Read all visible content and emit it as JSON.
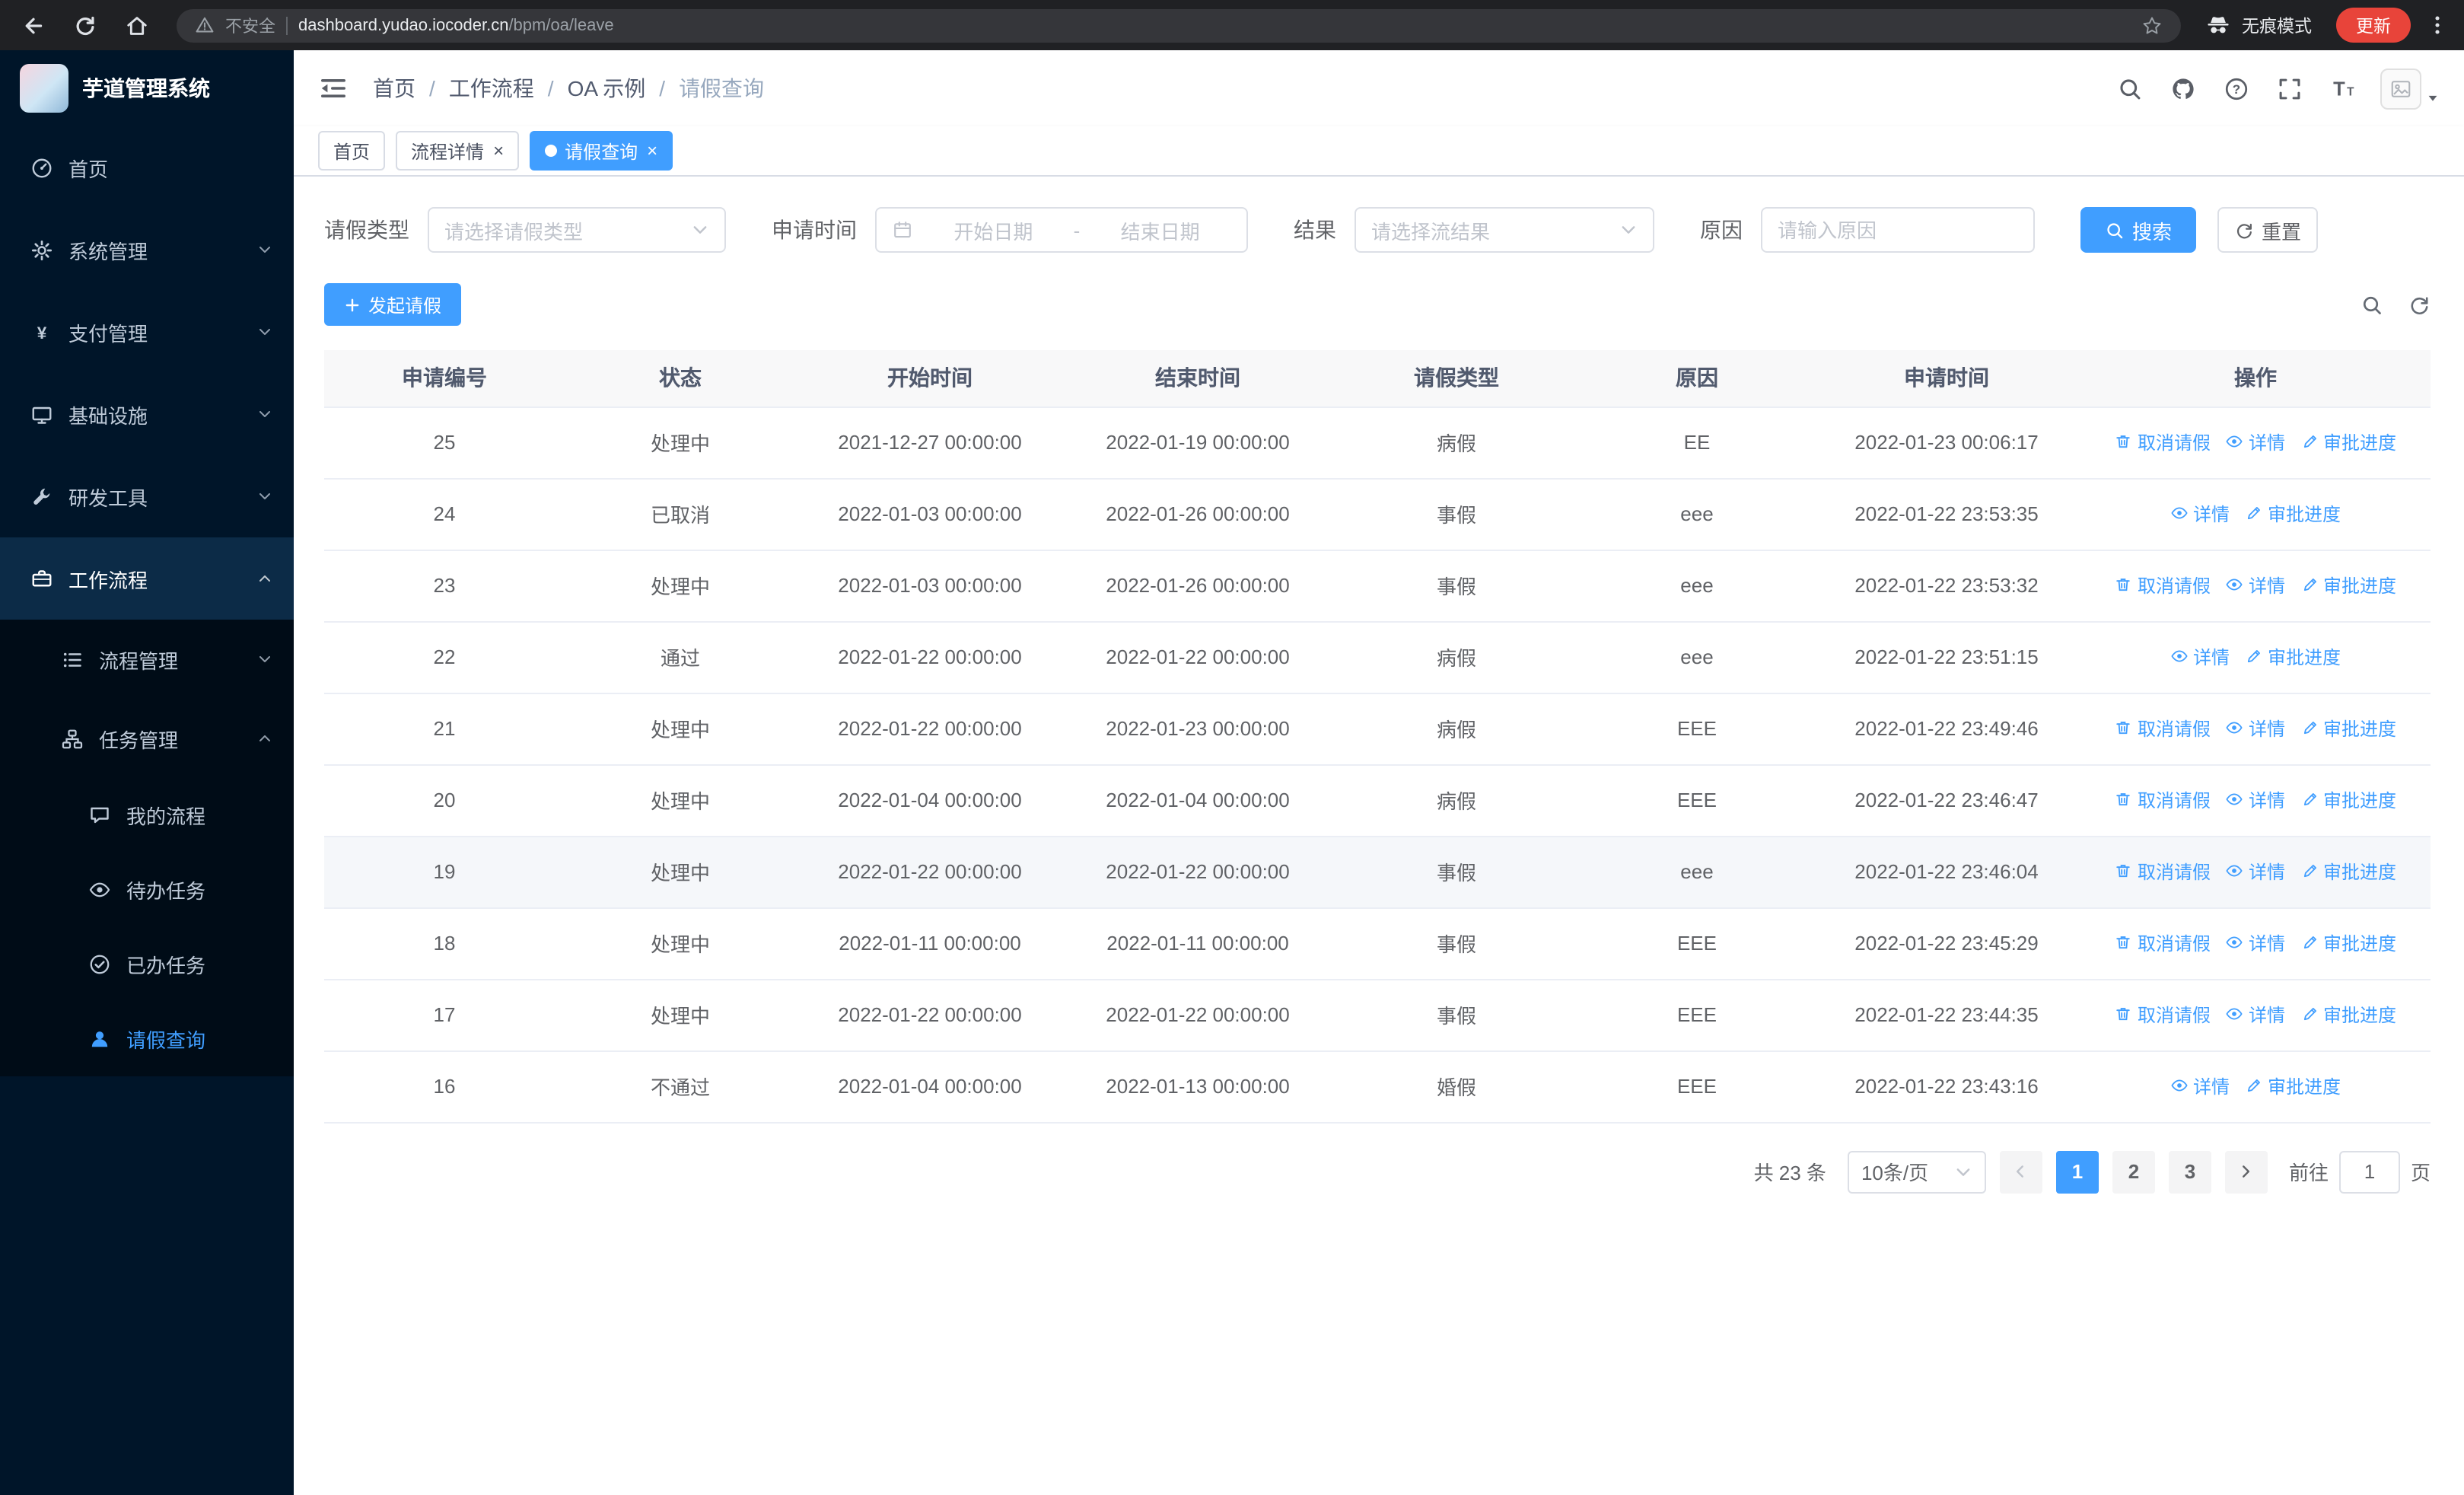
{
  "browser": {
    "nav_icons": [
      "back-icon",
      "reload-icon",
      "home-icon"
    ],
    "security_label": "不安全",
    "url_domain": "dashboard.yudao.iocoder.cn",
    "url_path": "/bpm/oa/leave",
    "bookmark_icon": "star-icon",
    "warning_icon": "warning-icon",
    "incognito_icon": "incognito-icon",
    "incognito_label": "无痕模式",
    "update_label": "更新",
    "menu_icon": "kebab-icon"
  },
  "sidebar": {
    "logo_title": "芋道管理系统",
    "items": [
      {
        "id": "home",
        "label": "首页",
        "icon": "dashboard-icon"
      },
      {
        "id": "system",
        "label": "系统管理",
        "icon": "gear-icon",
        "chevron": "down"
      },
      {
        "id": "pay",
        "label": "支付管理",
        "icon": "yen-icon",
        "chevron": "down"
      },
      {
        "id": "infra",
        "label": "基础设施",
        "icon": "infra-icon",
        "chevron": "down"
      },
      {
        "id": "devtools",
        "label": "研发工具",
        "icon": "tool-icon",
        "chevron": "down"
      },
      {
        "id": "workflow",
        "label": "工作流程",
        "icon": "workflow-icon",
        "chevron": "up",
        "active": true
      }
    ],
    "workflow_children": [
      {
        "id": "process-mgmt",
        "label": "流程管理",
        "icon": "process-icon",
        "chevron": "down"
      },
      {
        "id": "task-mgmt",
        "label": "任务管理",
        "icon": "task-icon",
        "chevron": "up",
        "children": [
          {
            "id": "my-process",
            "label": "我的流程",
            "icon": "chat-icon"
          },
          {
            "id": "todo-task",
            "label": "待办任务",
            "icon": "eye-icon"
          },
          {
            "id": "done-task",
            "label": "已办任务",
            "icon": "done-icon"
          },
          {
            "id": "leave-query",
            "label": "请假查询",
            "icon": "user-icon",
            "active": true
          }
        ]
      }
    ]
  },
  "header": {
    "breadcrumb": [
      "首页",
      "工作流程",
      "OA 示例",
      "请假查询"
    ],
    "icons": [
      "search-icon",
      "github-icon",
      "help-icon",
      "fullscreen-icon",
      "font-size-icon"
    ]
  },
  "tabs": [
    {
      "id": "home",
      "label": "首页",
      "closable": false,
      "active": false
    },
    {
      "id": "process-detail",
      "label": "流程详情",
      "closable": true,
      "active": false
    },
    {
      "id": "leave-query",
      "label": "请假查询",
      "closable": true,
      "active": true
    }
  ],
  "filters": {
    "leave_type_label": "请假类型",
    "leave_type_placeholder": "请选择请假类型",
    "apply_time_label": "申请时间",
    "date_start_placeholder": "开始日期",
    "date_separator": "-",
    "date_end_placeholder": "结束日期",
    "result_label": "结果",
    "result_placeholder": "请选择流结果",
    "reason_label": "原因",
    "reason_placeholder": "请输入原因",
    "search_button": "搜索",
    "reset_button": "重置"
  },
  "toolbar": {
    "create_button": "发起请假",
    "icons": [
      "search-icon",
      "refresh-icon"
    ]
  },
  "table": {
    "headers": [
      "申请编号",
      "状态",
      "开始时间",
      "结束时间",
      "请假类型",
      "原因",
      "申请时间",
      "操作"
    ],
    "action_labels": {
      "cancel": "取消请假",
      "detail": "详情",
      "progress": "审批进度"
    },
    "action_icons": {
      "cancel": "delete-icon",
      "detail": "view-icon",
      "progress": "edit-icon"
    },
    "rows": [
      {
        "id": "25",
        "status": "处理中",
        "start": "2021-12-27 00:00:00",
        "end": "2022-01-19 00:00:00",
        "type": "病假",
        "reason": "EE",
        "apply_time": "2022-01-23 00:06:17",
        "cancellable": true
      },
      {
        "id": "24",
        "status": "已取消",
        "start": "2022-01-03 00:00:00",
        "end": "2022-01-26 00:00:00",
        "type": "事假",
        "reason": "eee",
        "apply_time": "2022-01-22 23:53:35",
        "cancellable": false
      },
      {
        "id": "23",
        "status": "处理中",
        "start": "2022-01-03 00:00:00",
        "end": "2022-01-26 00:00:00",
        "type": "事假",
        "reason": "eee",
        "apply_time": "2022-01-22 23:53:32",
        "cancellable": true
      },
      {
        "id": "22",
        "status": "通过",
        "start": "2022-01-22 00:00:00",
        "end": "2022-01-22 00:00:00",
        "type": "病假",
        "reason": "eee",
        "apply_time": "2022-01-22 23:51:15",
        "cancellable": false
      },
      {
        "id": "21",
        "status": "处理中",
        "start": "2022-01-22 00:00:00",
        "end": "2022-01-23 00:00:00",
        "type": "病假",
        "reason": "EEE",
        "apply_time": "2022-01-22 23:49:46",
        "cancellable": true
      },
      {
        "id": "20",
        "status": "处理中",
        "start": "2022-01-04 00:00:00",
        "end": "2022-01-04 00:00:00",
        "type": "病假",
        "reason": "EEE",
        "apply_time": "2022-01-22 23:46:47",
        "cancellable": true
      },
      {
        "id": "19",
        "status": "处理中",
        "start": "2022-01-22 00:00:00",
        "end": "2022-01-22 00:00:00",
        "type": "事假",
        "reason": "eee",
        "apply_time": "2022-01-22 23:46:04",
        "cancellable": true,
        "hover": true
      },
      {
        "id": "18",
        "status": "处理中",
        "start": "2022-01-11 00:00:00",
        "end": "2022-01-11 00:00:00",
        "type": "事假",
        "reason": "EEE",
        "apply_time": "2022-01-22 23:45:29",
        "cancellable": true
      },
      {
        "id": "17",
        "status": "处理中",
        "start": "2022-01-22 00:00:00",
        "end": "2022-01-22 00:00:00",
        "type": "事假",
        "reason": "EEE",
        "apply_time": "2022-01-22 23:44:35",
        "cancellable": true
      },
      {
        "id": "16",
        "status": "不通过",
        "start": "2022-01-04 00:00:00",
        "end": "2022-01-13 00:00:00",
        "type": "婚假",
        "reason": "EEE",
        "apply_time": "2022-01-22 23:43:16",
        "cancellable": false
      }
    ]
  },
  "pagination": {
    "total_text": "共 23 条",
    "page_size": "10条/页",
    "pages": [
      "1",
      "2",
      "3"
    ],
    "active_page": "1",
    "goto_label": "前往",
    "goto_value": "1",
    "goto_suffix": "页"
  },
  "colors": {
    "primary": "#409eff",
    "sidebar_bg": "#001529",
    "submenu_bg": "#000c17",
    "update_chip": "#e8443a"
  }
}
